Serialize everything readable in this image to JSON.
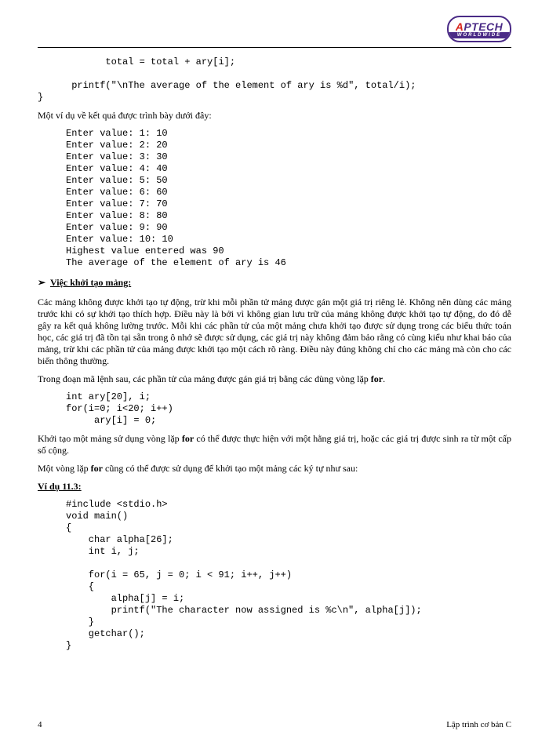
{
  "logo": {
    "name": "APTECH",
    "tagline": "WORLDWIDE"
  },
  "code_top": "            total = total + ary[i];\n\n      printf(\"\\nThe average of the element of ary is %d\", total/i);\n}",
  "para_result_intro": "Một ví dụ về kết quả được trình bày dưới đây:",
  "output_block": "Enter value: 1: 10\nEnter value: 2: 20\nEnter value: 3: 30\nEnter value: 4: 40\nEnter value: 5: 50\nEnter value: 6: 60\nEnter value: 7: 70\nEnter value: 8: 80\nEnter value: 9: 90\nEnter value: 10: 10\nHighest value entered was 90\nThe average of the element of ary is 46",
  "heading_init": "Việc khởi tạo mảng:",
  "para_init_body": "Các mảng không được khởi tạo tự động, trừ khi mỗi phần tử mảng được gán một giá trị riêng lẻ. Không nên dùng các mảng trước khi có sự khởi tạo thích hợp. Điều này là bởi vì không gian lưu trữ của mảng không được khởi tạo tự động, do đó dễ gây ra kết quả không lường trước. Mỗi khi các phần tử của một mảng chưa khởi tạo được sử dụng trong các biểu thức toán học, các giá trị đã tồn tại sẵn trong ô nhớ sẽ được sử dụng, các giá trị này không đảm bảo rằng có cùng kiểu như khai báo của mảng, trừ khi các phần tử của mảng được khởi tạo một cách rõ ràng. Điều này đúng không chỉ cho các mảng mà còn cho các biến thông thường.",
  "para_for_intro_pre": "Trong đoạn mã lệnh sau, các phần tử của mảng được gán giá trị bằng các dùng vòng lặp ",
  "bold_for": "for",
  "para_for_intro_post": ".",
  "code_for": "int ary[20], i;\nfor(i=0; i<20; i++)\n     ary[i] = 0;",
  "para_for_body_pre": "Khởi tạo một mảng sử dụng vòng lặp ",
  "para_for_body_post": " có thể được thực hiện với một hằng giá trị, hoặc các giá trị được sinh ra từ một cấp số cộng.",
  "para_for_char_pre": "Một vòng lặp ",
  "para_for_char_post": " cũng có thể được sử dụng để khởi tạo một mảng các ký tự như sau:",
  "example_label": "Ví dụ 11.3:",
  "code_example": "#include <stdio.h>\nvoid main()\n{\n    char alpha[26];\n    int i, j;\n\n    for(i = 65, j = 0; i < 91; i++, j++)\n    {\n        alpha[j] = i;\n        printf(\"The character now assigned is %c\\n\", alpha[j]);\n    }\n    getchar();\n}",
  "footer": {
    "page": "4",
    "title": "Lập trình cơ bản C"
  }
}
